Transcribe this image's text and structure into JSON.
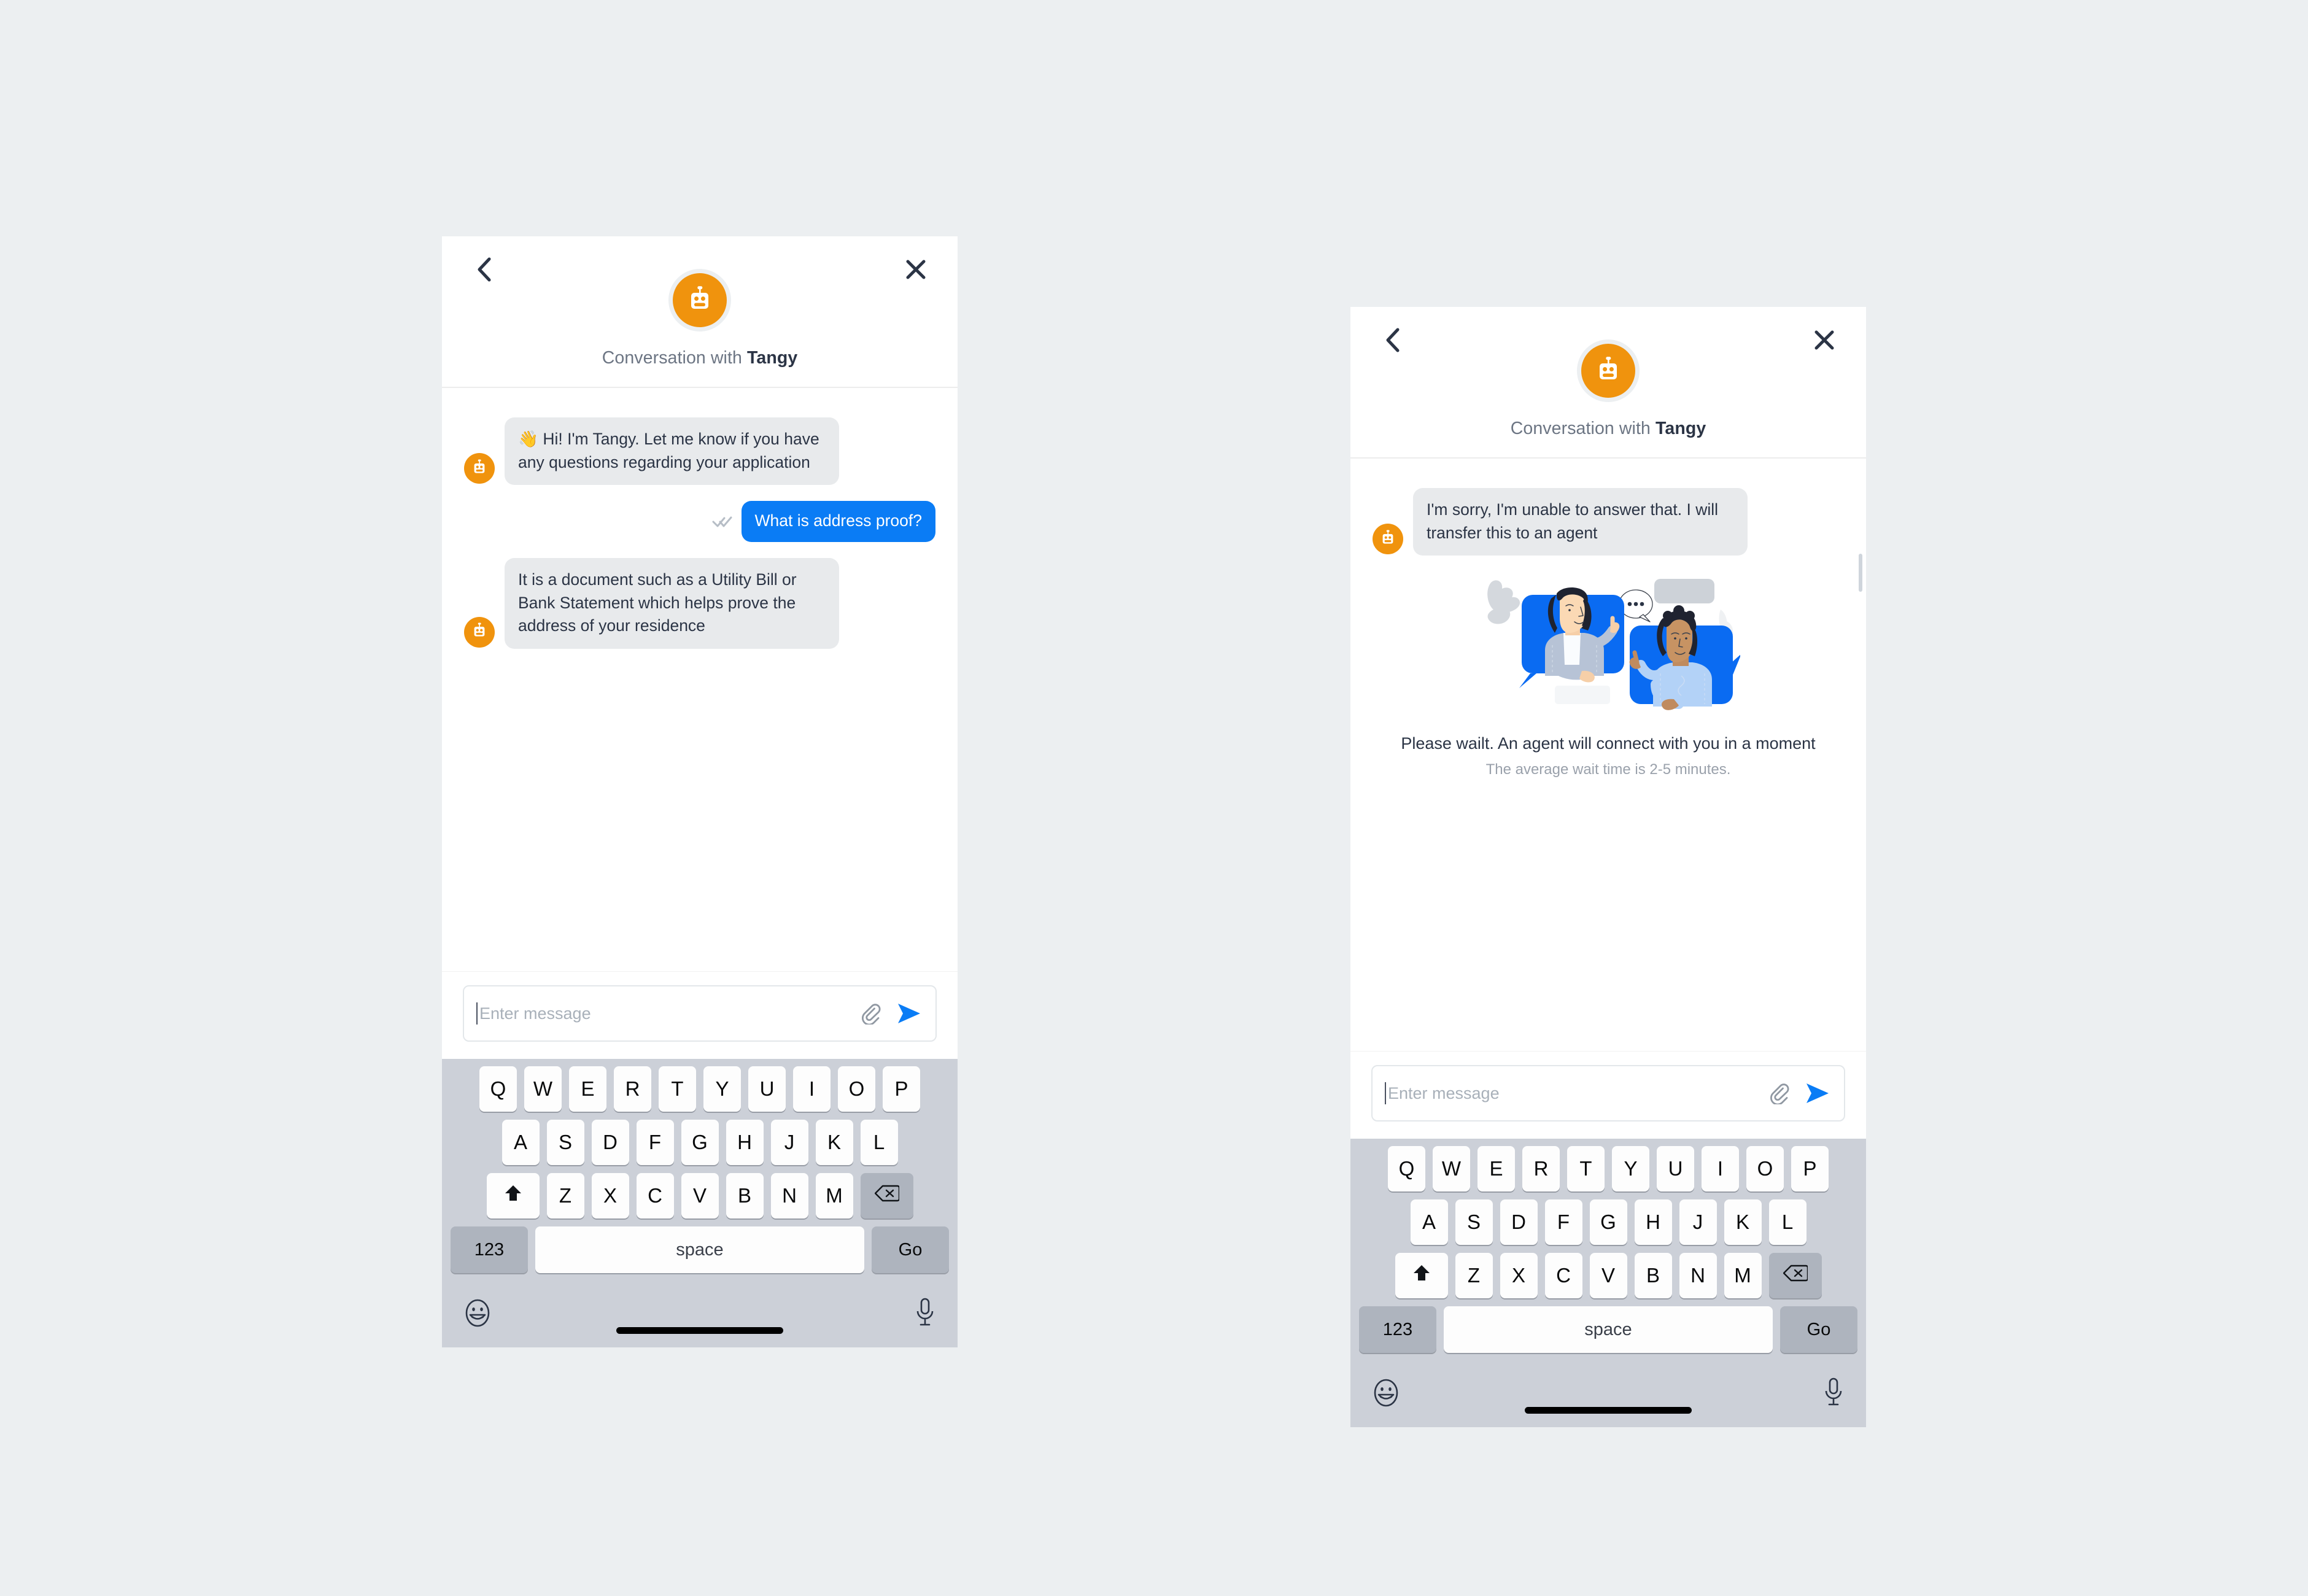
{
  "background_color": "#eceff1",
  "brand": {
    "bot_orange": "#f0930d",
    "user_bubble_blue": "#0a7cf5",
    "bot_bubble_gray": "#e8eaec",
    "text_dark": "#2b3445",
    "text_muted": "#9aa1ab",
    "keyboard_bg": "#ccd0d8"
  },
  "screens": [
    {
      "id": "conversation-screen",
      "header": {
        "back_icon": "chevron-left-icon",
        "close_icon": "close-icon",
        "avatar_icon": "robot-avatar-icon",
        "title_prefix": "Conversation with ",
        "title_name": "Tangy"
      },
      "messages": [
        {
          "sender": "bot",
          "avatar_icon": "robot-avatar-icon",
          "text": "👋 Hi! I'm Tangy. Let me know if you have any questions regarding your application"
        },
        {
          "sender": "user",
          "status_icon": "double-check-icon",
          "text": "What is address proof?"
        },
        {
          "sender": "bot",
          "avatar_icon": "robot-avatar-icon",
          "text": "It is a document such as a Utility Bill or Bank Statement which helps prove the address of your residence"
        }
      ],
      "composer": {
        "placeholder": "Enter message",
        "attach_icon": "paperclip-icon",
        "send_icon": "send-arrow-icon",
        "caret_visible": true
      }
    },
    {
      "id": "agent-transfer-screen",
      "header": {
        "back_icon": "chevron-left-icon",
        "close_icon": "close-icon",
        "avatar_icon": "robot-avatar-icon",
        "title_prefix": "Conversation with ",
        "title_name": "Tangy"
      },
      "messages": [
        {
          "sender": "bot",
          "avatar_icon": "robot-avatar-icon",
          "text": "I'm sorry, I'm unable to answer that. I will transfer this to an agent"
        }
      ],
      "transfer": {
        "illustration_icon": "two-people-chat-illustration",
        "wait_title": "Please wailt. An agent will connect with you in a moment",
        "wait_subtitle": "The average wait time is 2-5 minutes."
      },
      "composer": {
        "placeholder": "Enter message",
        "attach_icon": "paperclip-icon",
        "send_icon": "send-arrow-icon",
        "caret_visible": true
      }
    }
  ],
  "keyboard": {
    "row1": [
      "Q",
      "W",
      "E",
      "R",
      "T",
      "Y",
      "U",
      "I",
      "O",
      "P"
    ],
    "row2": [
      "A",
      "S",
      "D",
      "F",
      "G",
      "H",
      "J",
      "K",
      "L"
    ],
    "row3_letters": [
      "Z",
      "X",
      "C",
      "V",
      "B",
      "N",
      "M"
    ],
    "shift_icon": "shift-arrow-icon",
    "delete_icon": "backspace-icon",
    "numeric_label": "123",
    "space_label": "space",
    "return_label": "Go",
    "emoji_icon": "emoji-smiley-icon",
    "mic_icon": "microphone-icon",
    "home_indicator": "home-indicator-bar"
  }
}
